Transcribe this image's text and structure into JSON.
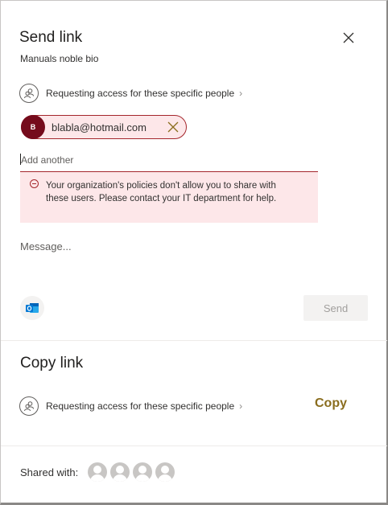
{
  "send_link": {
    "title": "Send link",
    "subtitle": "Manuals noble bio",
    "access_text": "Requesting access for these specific people",
    "recipient": {
      "initial": "B",
      "email": "blabla@hotmail.com"
    },
    "add_placeholder": "Add another",
    "error": "Your organization's policies don't allow you to share with these users. Please contact your IT department for help.",
    "message_placeholder": "Message...",
    "send_label": "Send"
  },
  "copy_link": {
    "title": "Copy link",
    "access_text": "Requesting access for these specific people",
    "copy_label": "Copy"
  },
  "shared_with": {
    "label": "Shared with:"
  },
  "colors": {
    "error_border": "#a4262c",
    "error_bg": "#fde7e9",
    "avatar_bg": "#750b1c",
    "copy_accent": "#8a6d1e"
  }
}
